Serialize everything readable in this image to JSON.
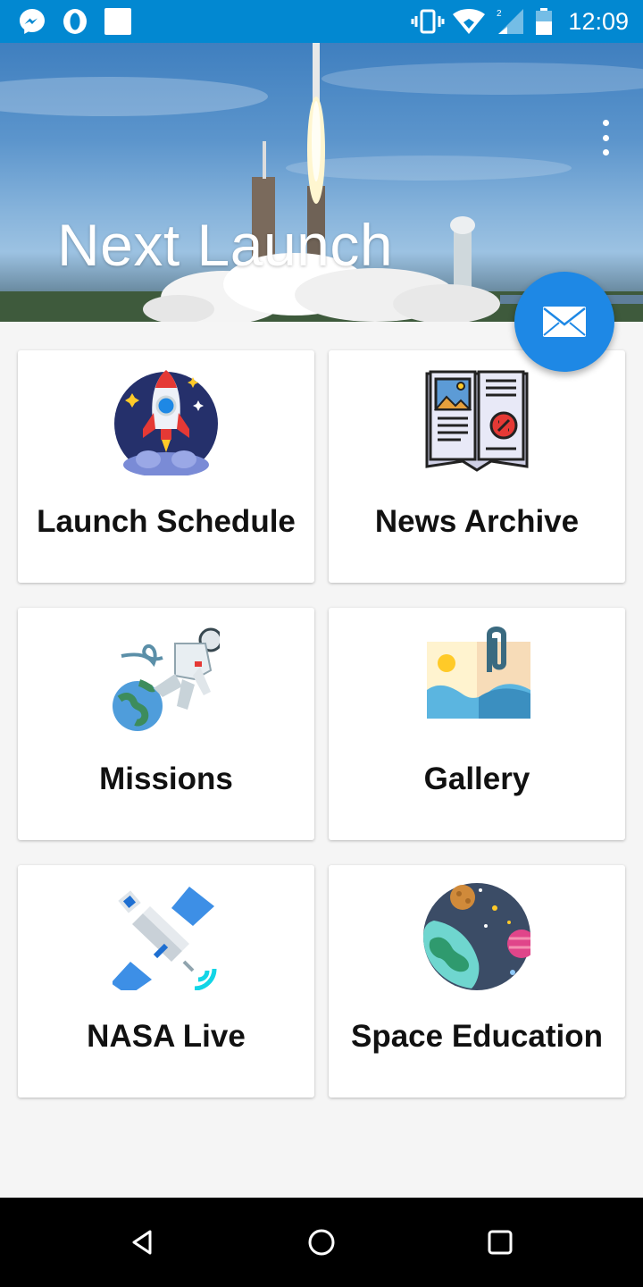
{
  "status_bar": {
    "time": "12:09",
    "left_icons": [
      "messenger-icon",
      "opera-icon",
      "notification-square-icon"
    ],
    "right_icons": [
      "vibrate-icon",
      "wifi-icon",
      "signal-icon",
      "battery-icon"
    ]
  },
  "header": {
    "title": "Next Launch",
    "menu_icon": "more-vert-icon"
  },
  "fab": {
    "icon": "mail-icon",
    "color": "#1e88e5"
  },
  "cards": [
    {
      "label": "Launch Schedule",
      "icon": "rocket-icon"
    },
    {
      "label": "News Archive",
      "icon": "newspaper-icon"
    },
    {
      "label": "Missions",
      "icon": "astronaut-icon"
    },
    {
      "label": "Gallery",
      "icon": "gallery-icon"
    },
    {
      "label": "NASA Live",
      "icon": "satellite-icon"
    },
    {
      "label": "Space Education",
      "icon": "planets-icon"
    }
  ],
  "nav_bar": {
    "icons": [
      "back-icon",
      "home-icon",
      "recents-icon"
    ]
  },
  "colors": {
    "status_bar": "#0288d1",
    "accent": "#1e88e5",
    "background": "#f5f5f5"
  }
}
